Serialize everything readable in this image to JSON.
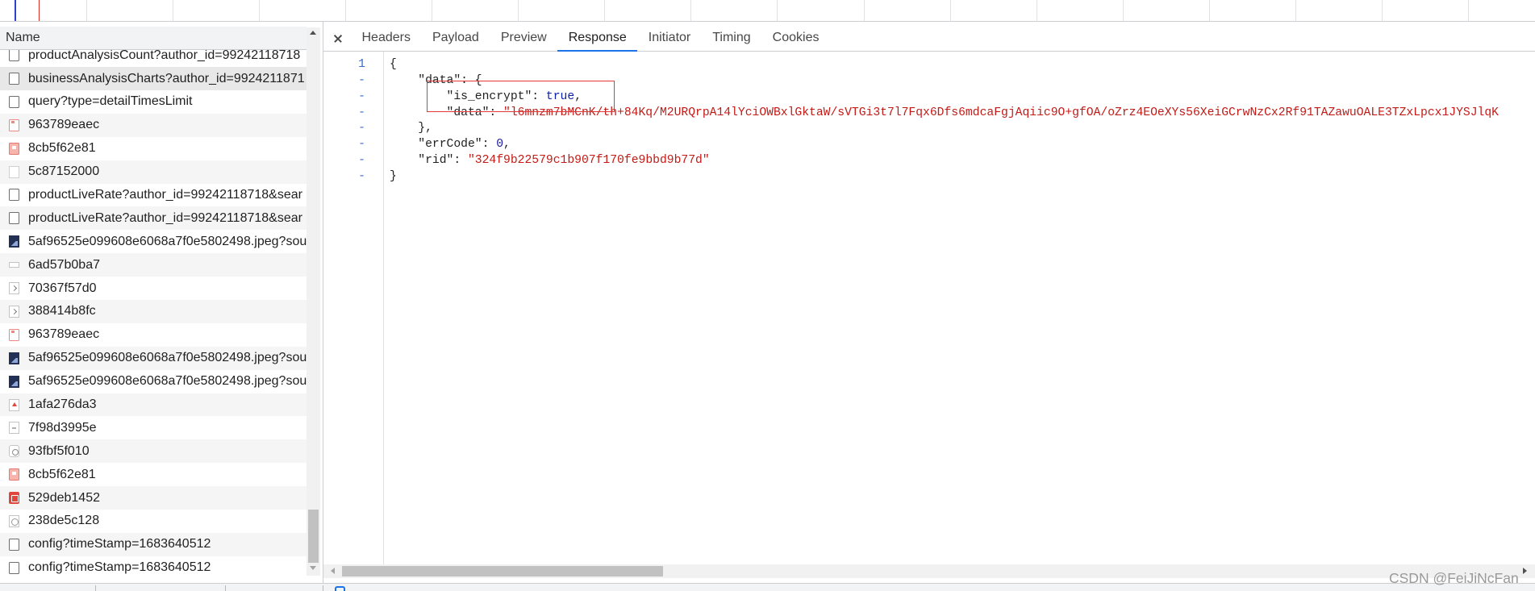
{
  "request_list": {
    "column_header": "Name",
    "rows": [
      {
        "name": "productAnalysisCount?author_id=99242118718",
        "icon": "fetch-request-icon"
      },
      {
        "name": "businessAnalysisCharts?author_id=9924211871",
        "icon": "fetch-request-icon",
        "highlighted": true
      },
      {
        "name": "query?type=detailTimesLimit",
        "icon": "fetch-request-icon"
      },
      {
        "name": "963789eaec",
        "icon": "image-icon"
      },
      {
        "name": "8cb5f62e81",
        "icon": "image-filled-icon"
      },
      {
        "name": "5c87152000",
        "icon": "blank-file-icon"
      },
      {
        "name": "productLiveRate?author_id=99242118718&sear",
        "icon": "fetch-request-icon"
      },
      {
        "name": "productLiveRate?author_id=99242118718&sear",
        "icon": "fetch-request-icon"
      },
      {
        "name": "5af96525e099608e6068a7f0e5802498.jpeg?sou",
        "icon": "photo-thumbnail-icon"
      },
      {
        "name": "6ad57b0ba7",
        "icon": "bar-icon"
      },
      {
        "name": "70367f57d0",
        "icon": "script-icon"
      },
      {
        "name": "388414b8fc",
        "icon": "script-icon"
      },
      {
        "name": "963789eaec",
        "icon": "image-icon"
      },
      {
        "name": "5af96525e099608e6068a7f0e5802498.jpeg?sou",
        "icon": "photo-thumbnail-icon"
      },
      {
        "name": "5af96525e099608e6068a7f0e5802498.jpeg?sou",
        "icon": "photo-thumbnail-icon"
      },
      {
        "name": "1afa276da3",
        "icon": "arrow-up-icon"
      },
      {
        "name": "7f98d3995e",
        "icon": "file-icon"
      },
      {
        "name": "93fbf5f010",
        "icon": "font-icon"
      },
      {
        "name": "8cb5f62e81",
        "icon": "image-filled-icon"
      },
      {
        "name": "529deb1452",
        "icon": "red-image-icon"
      },
      {
        "name": "238de5c128",
        "icon": "circle-icon"
      },
      {
        "name": "config?timeStamp=1683640512",
        "icon": "fetch-request-icon"
      },
      {
        "name": "config?timeStamp=1683640512",
        "icon": "fetch-request-icon"
      }
    ]
  },
  "details": {
    "tabs": [
      {
        "label": "Headers"
      },
      {
        "label": "Payload"
      },
      {
        "label": "Preview"
      },
      {
        "label": "Response",
        "active": true
      },
      {
        "label": "Initiator"
      },
      {
        "label": "Timing"
      },
      {
        "label": "Cookies"
      }
    ],
    "response": {
      "gutter": [
        "1",
        "-",
        "-",
        "-",
        "-",
        "-",
        "-",
        "-"
      ],
      "lines": [
        {
          "tokens": [
            {
              "text": "{",
              "kind": "punct"
            }
          ]
        },
        {
          "tokens": [
            {
              "text": "\"data\"",
              "kind": "key"
            },
            {
              "text": ": {",
              "kind": "punct"
            }
          ]
        },
        {
          "tokens": [
            {
              "text": "\"is_encrypt\"",
              "kind": "key"
            },
            {
              "text": ": ",
              "kind": "punct"
            },
            {
              "text": "true",
              "kind": "bool"
            },
            {
              "text": ",",
              "kind": "punct"
            }
          ]
        },
        {
          "tokens": [
            {
              "text": "\"data\"",
              "kind": "key"
            },
            {
              "text": ": ",
              "kind": "punct"
            },
            {
              "text": "\"l6mnzm7bMCnK/th+84Kq/M2URQrpA14lYciOWBxlGktaW/sVTGi3t7l7Fqx6Dfs6mdcaFgjAqiic9O+gfOA/oZrz4EOeXYs56XeiGCrwNzCx2Rf91TAZawuOALE3TZxLpcx1JYSJlqK",
              "kind": "string"
            }
          ]
        },
        {
          "tokens": [
            {
              "text": "},",
              "kind": "punct"
            }
          ]
        },
        {
          "tokens": [
            {
              "text": "\"errCode\"",
              "kind": "key"
            },
            {
              "text": ": ",
              "kind": "punct"
            },
            {
              "text": "0",
              "kind": "number"
            },
            {
              "text": ",",
              "kind": "punct"
            }
          ]
        },
        {
          "tokens": [
            {
              "text": "\"rid\"",
              "kind": "key"
            },
            {
              "text": ": ",
              "kind": "punct"
            },
            {
              "text": "\"324f9b22579c1b907f170fe9bbd9b77d\"",
              "kind": "string"
            }
          ]
        },
        {
          "tokens": [
            {
              "text": "}",
              "kind": "punct"
            }
          ]
        }
      ]
    }
  },
  "watermark": "CSDN @FeiJiNcFan",
  "colors": {
    "accent": "#1a73e8",
    "string": "#c41a16",
    "keyword": "#0d22aa",
    "number": "#1a1aa6",
    "annotation": "#e53935"
  }
}
